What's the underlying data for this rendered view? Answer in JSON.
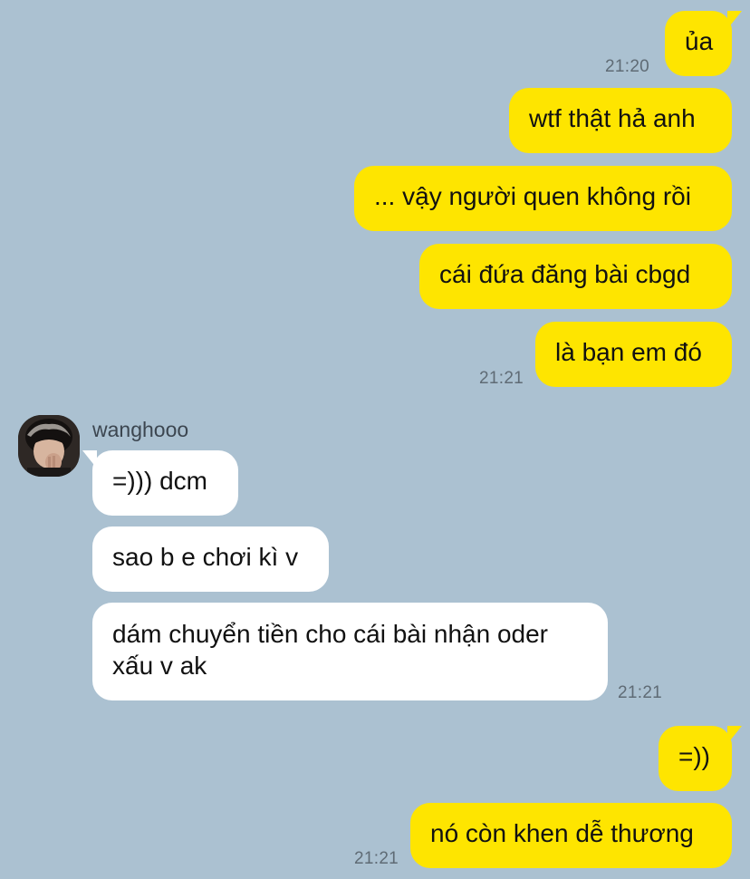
{
  "messages": [
    {
      "dir": "out",
      "text": "ủa"
    },
    {
      "dir": "out",
      "text": "wtf thật hả anh"
    },
    {
      "dir": "out",
      "text": "... vậy người quen không rồi"
    },
    {
      "dir": "out",
      "text": "cái đứa đăng bài cbgd"
    },
    {
      "dir": "out",
      "text": "là bạn em đó"
    },
    {
      "dir": "in",
      "text": "=))) dcm"
    },
    {
      "dir": "in",
      "text": "sao b e chơi kì v"
    },
    {
      "dir": "in",
      "text": "dám chuyển tiền cho cái bài nhận oder xấu v ak"
    },
    {
      "dir": "out",
      "text": "=))"
    },
    {
      "dir": "out",
      "text": "nó còn khen dễ thương"
    }
  ],
  "timestamps": [
    "21:20",
    "21:21",
    "21:21",
    "21:21"
  ],
  "sender": {
    "name": "wanghooo"
  },
  "colors": {
    "background": "#abc1d1",
    "outgoing": "#fee500",
    "incoming": "#ffffff"
  }
}
